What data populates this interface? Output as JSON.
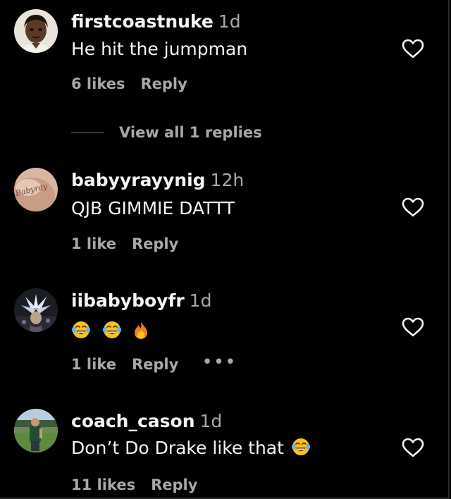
{
  "colors": {
    "background": "#000000",
    "primary_text": "#f5f5f5",
    "secondary_text": "#a8a8a8"
  },
  "comments": [
    {
      "username": "firstcoastnuke",
      "time": "1d",
      "text": "He hit the jumpman",
      "likes": "6 likes",
      "reply_label": "Reply",
      "view_replies": "View all 1 replies",
      "avatar_icon": "portrait-avatar",
      "heart_icon": "heart-outline-icon"
    },
    {
      "username": "babyyrayynig",
      "time": "12h",
      "text": "QJB GIMMIE DATTT",
      "likes": "1 like",
      "reply_label": "Reply",
      "avatar_icon": "handwriting-avatar",
      "avatar_text": "Babyray",
      "heart_icon": "heart-outline-icon"
    },
    {
      "username": "iibabyboyfr",
      "time": "1d",
      "text": "",
      "emojis": [
        "face-with-tears-of-joy-emoji",
        "face-with-tears-of-joy-emoji",
        "fire-emoji"
      ],
      "likes": "1 like",
      "reply_label": "Reply",
      "more_label": "•••",
      "avatar_icon": "anime-avatar",
      "heart_icon": "heart-outline-icon"
    },
    {
      "username": "coach_cason",
      "time": "1d",
      "text": "Don’t Do Drake like that",
      "emojis": [
        "face-with-tears-of-joy-emoji"
      ],
      "likes": "11 likes",
      "reply_label": "Reply",
      "avatar_icon": "field-avatar",
      "heart_icon": "heart-outline-icon"
    }
  ]
}
